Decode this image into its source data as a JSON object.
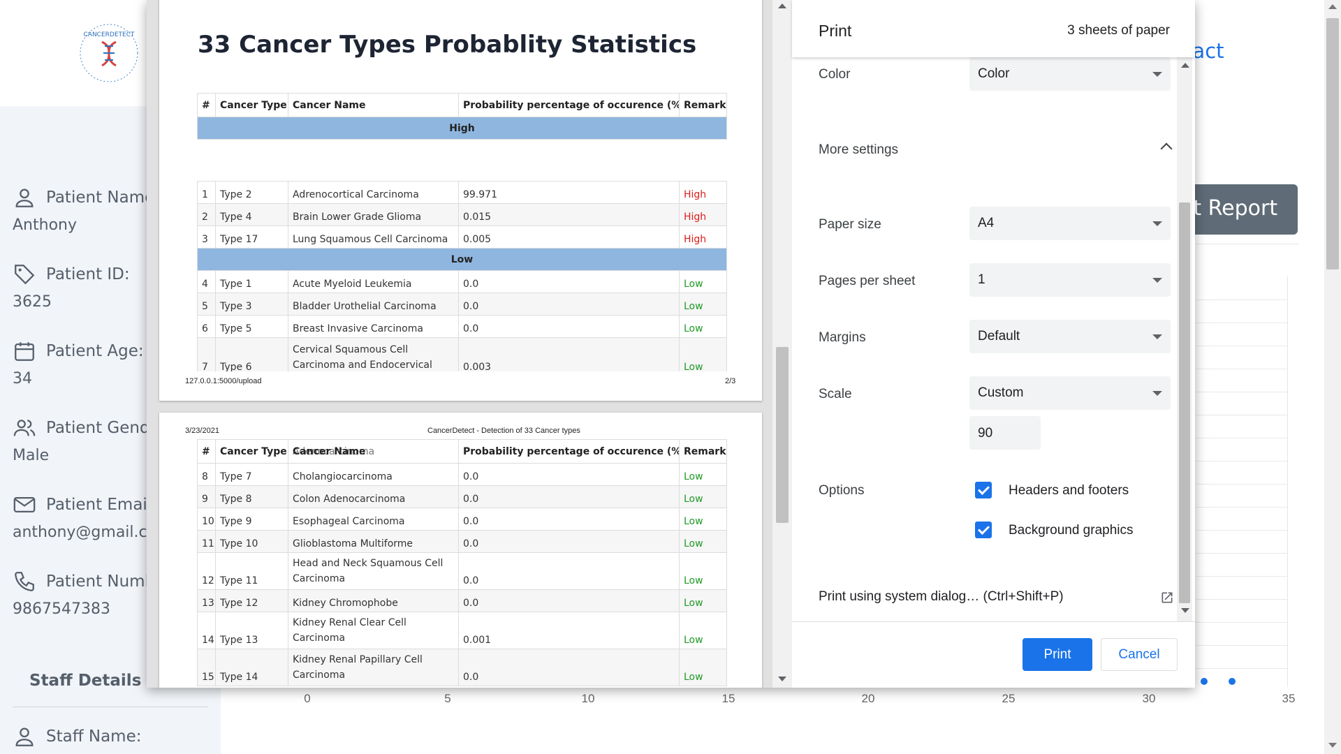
{
  "background_page": {
    "logo_text": "CANCERDETECT",
    "patient": [
      {
        "label": "Patient Name",
        "value": "Anthony",
        "icon": "person-icon"
      },
      {
        "label": "Patient ID:",
        "value": "3625",
        "icon": "tag-icon"
      },
      {
        "label": "Patient Age:",
        "value": "34",
        "icon": "calendar-icon"
      },
      {
        "label": "Patient Gend",
        "value": "Male",
        "icon": "people-icon"
      },
      {
        "label": "Patient Emai",
        "value": "anthony@gmail.c",
        "icon": "mail-icon"
      },
      {
        "label": "Patient Numl",
        "value": "9867547383",
        "icon": "phone-icon"
      }
    ],
    "staff_details_heading": "Staff Details",
    "staff_name_label": "Staff Name:",
    "contact_link": "ıtact",
    "report_button": "ıt Report",
    "x_axis_ticks": [
      "0",
      "5",
      "10",
      "15",
      "20",
      "25",
      "30",
      "35"
    ]
  },
  "preview": {
    "doc_title": "33 Cancer Types Probablity Statistics",
    "columns": [
      "#",
      "Cancer Type",
      "Cancer Name",
      "Probability percentage of occurence (%)",
      "Remark"
    ],
    "band_high": "High",
    "band_low": "Low",
    "page1_rows": [
      {
        "n": "1",
        "type": "Type 2",
        "name": "Adrenocortical Carcinoma",
        "prob": "99.971",
        "remark": "High"
      },
      {
        "n": "2",
        "type": "Type 4",
        "name": "Brain Lower Grade Glioma",
        "prob": "0.015",
        "remark": "High"
      },
      {
        "n": "3",
        "type": "Type 17",
        "name": "Lung Squamous Cell Carcinoma",
        "prob": "0.005",
        "remark": "High"
      },
      {
        "n": "4",
        "type": "Type 1",
        "name": "Acute Myeloid Leukemia",
        "prob": "0.0",
        "remark": "Low"
      },
      {
        "n": "5",
        "type": "Type 3",
        "name": "Bladder Urothelial Carcinoma",
        "prob": "0.0",
        "remark": "Low"
      },
      {
        "n": "6",
        "type": "Type 5",
        "name": "Breast Invasive Carcinoma",
        "prob": "0.0",
        "remark": "Low"
      },
      {
        "n": "7",
        "type": "Type 6",
        "name": "Cervical Squamous Cell Carcinoma and Endocervical",
        "prob": "0.003",
        "remark": "Low"
      }
    ],
    "footer_url": "127.0.0.1:5000/upload",
    "footer_page": "2/3",
    "header_date": "3/23/2021",
    "header_title": "CancerDetect - Detection of 33 Cancer types",
    "page2_col_overlap": "Adenocarcinoma",
    "page2_rows": [
      {
        "n": "8",
        "type": "Type 7",
        "name": "Cholangiocarcinoma",
        "prob": "0.0",
        "remark": "Low"
      },
      {
        "n": "9",
        "type": "Type 8",
        "name": "Colon Adenocarcinoma",
        "prob": "0.0",
        "remark": "Low"
      },
      {
        "n": "10",
        "type": "Type 9",
        "name": "Esophageal Carcinoma",
        "prob": "0.0",
        "remark": "Low"
      },
      {
        "n": "11",
        "type": "Type 10",
        "name": "Glioblastoma Multiforme",
        "prob": "0.0",
        "remark": "Low"
      },
      {
        "n": "12",
        "type": "Type 11",
        "name": "Head and Neck Squamous Cell Carcinoma",
        "prob": "0.0",
        "remark": "Low"
      },
      {
        "n": "13",
        "type": "Type 12",
        "name": "Kidney Chromophobe",
        "prob": "0.0",
        "remark": "Low"
      },
      {
        "n": "14",
        "type": "Type 13",
        "name": "Kidney Renal Clear Cell Carcinoma",
        "prob": "0.001",
        "remark": "Low"
      },
      {
        "n": "15",
        "type": "Type 14",
        "name": "Kidney Renal Papillary Cell Carcinoma",
        "prob": "0.0",
        "remark": "Low"
      }
    ]
  },
  "settings": {
    "title": "Print",
    "sheets": "3 sheets of paper",
    "color_label": "Color",
    "color_value": "Color",
    "more_settings": "More settings",
    "paper_size_label": "Paper size",
    "paper_size_value": "A4",
    "pages_per_sheet_label": "Pages per sheet",
    "pages_per_sheet_value": "1",
    "margins_label": "Margins",
    "margins_value": "Default",
    "scale_label": "Scale",
    "scale_value": "Custom",
    "scale_input": "90",
    "options_label": "Options",
    "opt_headers": "Headers and footers",
    "opt_background": "Background graphics",
    "system_dialog": "Print using system dialog… (Ctrl+Shift+P)",
    "print_button": "Print",
    "cancel_button": "Cancel",
    "accent_color": "#1a73e8"
  }
}
